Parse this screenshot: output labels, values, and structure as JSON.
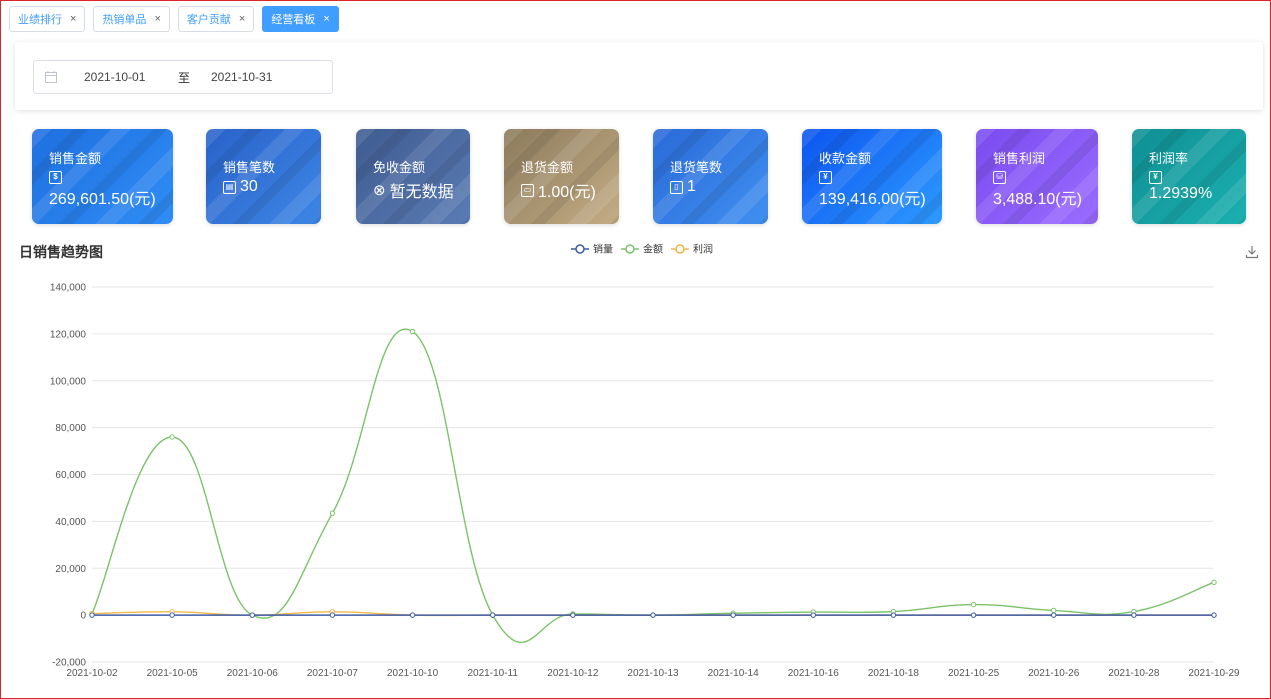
{
  "tabs": [
    {
      "label": "业绩排行",
      "close": "×"
    },
    {
      "label": "热销单品",
      "close": "×"
    },
    {
      "label": "客户贡献",
      "close": "×"
    },
    {
      "label": "经营看板",
      "close": "×",
      "active": true
    }
  ],
  "filter": {
    "start_date": "2021-10-01",
    "separator": "至",
    "end_date": "2021-10-31"
  },
  "cards": [
    {
      "label": "销售金额",
      "icon": "dollar-icon",
      "icon_text": "$",
      "value": "269,601.50(元)",
      "colors": [
        "#1f6fe0",
        "#2f8df5"
      ]
    },
    {
      "label": "销售笔数",
      "icon": "receipt-icon",
      "icon_text": "▤",
      "value": "30",
      "colors": [
        "#2a62c9",
        "#3d86e6"
      ]
    },
    {
      "label": "免收金额",
      "icon": "cancel-circle-icon",
      "icon_text": "⊗",
      "value": "暂无数据",
      "colors": [
        "#3f5c90",
        "#5a7bb5"
      ]
    },
    {
      "label": "退货金额",
      "icon": "wallet-icon",
      "icon_text": "▭",
      "value": "1.00(元)",
      "colors": [
        "#8c7a5c",
        "#c4ad85"
      ]
    },
    {
      "label": "退货笔数",
      "icon": "clipboard-icon",
      "icon_text": "▯",
      "value": "1",
      "colors": [
        "#2a6ad8",
        "#4090f0"
      ]
    },
    {
      "label": "收款金额",
      "icon": "cash-icon",
      "icon_text": "¥",
      "value": "139,416.00(元)",
      "colors": [
        "#0d55f0",
        "#2d9bff"
      ]
    },
    {
      "label": "销售利润",
      "icon": "coins-icon",
      "icon_text": "⛁",
      "value": "3,488.10(元)",
      "colors": [
        "#7a4cf0",
        "#9b6cff"
      ]
    },
    {
      "label": "利润率",
      "icon": "cash-icon",
      "icon_text": "¥",
      "value": "1.2939%",
      "colors": [
        "#0f8f93",
        "#1cb0b0"
      ]
    }
  ],
  "chart_title": "日销售趋势图",
  "chart_data": {
    "type": "line",
    "x": [
      "2021-10-02",
      "2021-10-05",
      "2021-10-06",
      "2021-10-07",
      "2021-10-10",
      "2021-10-11",
      "2021-10-12",
      "2021-10-13",
      "2021-10-14",
      "2021-10-16",
      "2021-10-18",
      "2021-10-25",
      "2021-10-26",
      "2021-10-28",
      "2021-10-29"
    ],
    "series": [
      {
        "name": "销量",
        "color": "#3d5aa8",
        "values": [
          0,
          0,
          0,
          0,
          0,
          0,
          0,
          0,
          0,
          0,
          0,
          0,
          0,
          0,
          0
        ]
      },
      {
        "name": "金额",
        "color": "#7cc26a",
        "values": [
          600,
          76000,
          0,
          43500,
          121000,
          0,
          500,
          0,
          800,
          1300,
          1500,
          4500,
          2000,
          1500,
          14000
        ]
      },
      {
        "name": "利润",
        "color": "#f2b84a",
        "values": [
          600,
          1400,
          0,
          1400,
          0,
          0,
          0,
          0,
          0,
          0,
          0,
          0,
          0,
          0,
          0
        ]
      }
    ],
    "ylim": [
      -20000,
      140000
    ],
    "yticks": [
      "-20,000",
      "0",
      "20,000",
      "40,000",
      "60,000",
      "80,000",
      "100,000",
      "120,000",
      "140,000"
    ],
    "ytick_values": [
      -20000,
      0,
      20000,
      40000,
      60000,
      80000,
      100000,
      120000,
      140000
    ],
    "legend": "top-center",
    "grid": true,
    "smooth": true
  }
}
